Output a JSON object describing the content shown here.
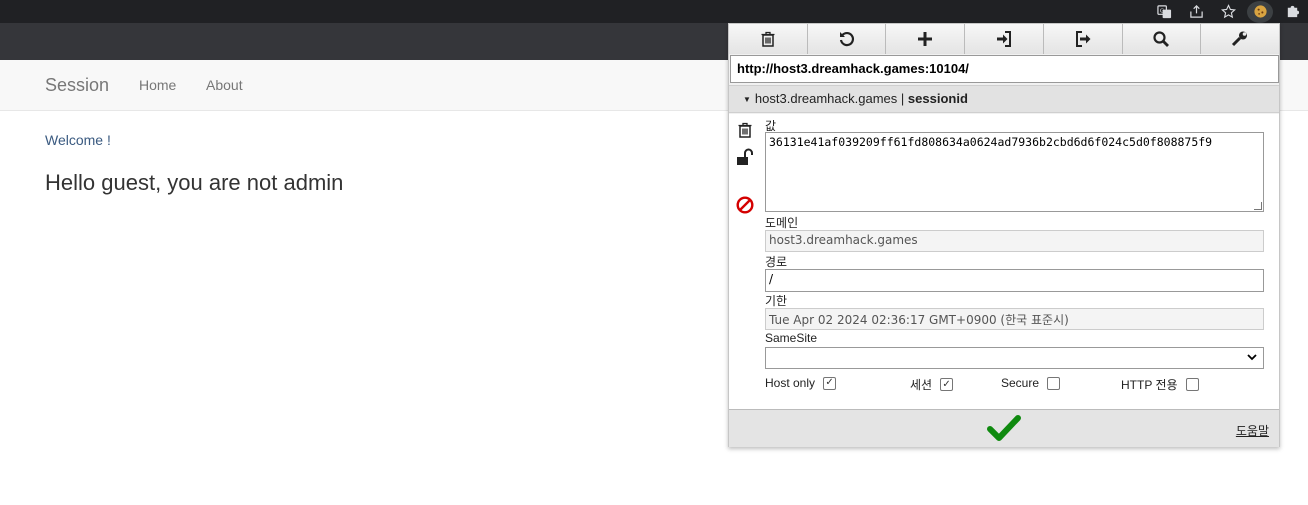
{
  "site": {
    "brand": "Session",
    "nav": {
      "home": "Home",
      "about": "About"
    },
    "welcome": "Welcome !",
    "message": "Hello guest, you are not admin"
  },
  "popup": {
    "url": "http://host3.dreamhack.games:10104/",
    "cookie_domain": "host3.dreamhack.games",
    "cookie_separator": "|",
    "cookie_name": "sessionid",
    "fields": {
      "value_label": "값",
      "value": "36131e41af039209ff61fd808634a0624ad7936b2cbd6d6f024c5d0f808875f9",
      "domain_label": "도메인",
      "domain": "host3.dreamhack.games",
      "path_label": "경로",
      "path": "/",
      "expires_label": "기한",
      "expires": "Tue Apr 02 2024 02:36:17 GMT+0900 (한국 표준시)",
      "samesite_label": "SameSite",
      "samesite": ""
    },
    "checkboxes": {
      "host_only_label": "Host only",
      "host_only_mark": "✓",
      "session_label": "세션",
      "session_mark": "✓",
      "secure_label": "Secure",
      "http_only_label": "HTTP 전용"
    },
    "help": "도움말"
  },
  "colors": {
    "save_check": "#0f8a0f",
    "block_icon": "#d40000"
  }
}
